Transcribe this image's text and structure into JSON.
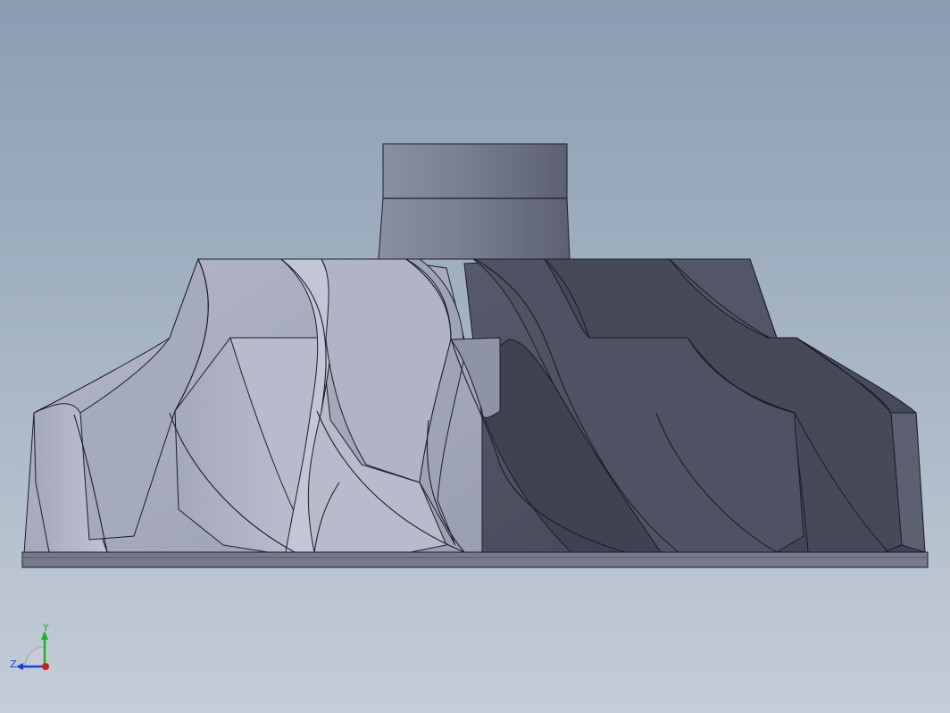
{
  "viewport": {
    "background_top": "#8a9db2",
    "background_bottom": "#c4cdd7"
  },
  "model": {
    "name": "impeller",
    "shade_light": "#a9adc0",
    "shade_mid": "#8f93a8",
    "shade_dark": "#4f5363",
    "edge": "#1c1d24"
  },
  "triad": {
    "y_label": "Y",
    "z_label": "Z",
    "y_color": "#1fae2a",
    "z_color": "#1d3fd1",
    "x_color": "#d11c1c"
  }
}
